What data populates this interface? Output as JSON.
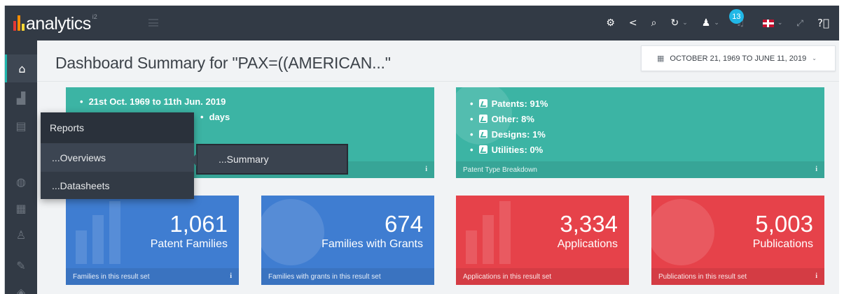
{
  "app": {
    "logo_text": "analytics",
    "logo_sup": "i2",
    "logo_bar_colors": [
      "#e53935",
      "#fb8c00",
      "#fdd835",
      "#43a047"
    ]
  },
  "topbar": {
    "notification_count": "13",
    "icons": [
      "cogs-icon",
      "share-icon",
      "search-icon",
      "refresh-icon",
      "user-icon",
      "bell-icon",
      "flag-icon",
      "fullscreen-icon",
      "help-icon"
    ]
  },
  "sidebar": {
    "icons": [
      "home-icon",
      "chart-icon",
      "document-icon",
      "globe-icon",
      "calendar-icon",
      "person-icon",
      "pen-icon",
      "stack-icon"
    ]
  },
  "header": {
    "title": "Dashboard Summary for \"PAX=((AMERICAN...\"",
    "date_range": "OCTOBER 21, 1969 TO JUNE 11, 2019"
  },
  "cards_top": [
    {
      "lines": [
        "21st Oct. 1969 to 11th Jun. 2019",
        "days"
      ],
      "footer": "",
      "color": "#3cb4a4"
    },
    {
      "lines": [
        "Patents: 91%",
        "Other: 8%",
        "Designs: 1%",
        "Utilities: 0%"
      ],
      "footer": "Patent Type Breakdown",
      "color": "#3cb4a4"
    }
  ],
  "cards_stats": [
    {
      "value": "1,061",
      "label": "Patent Families",
      "footer": "Families in this result set",
      "color": "#3f7dd1"
    },
    {
      "value": "674",
      "label": "Families with Grants",
      "footer": "Families with grants in this result set",
      "color": "#3f7dd1"
    },
    {
      "value": "3,334",
      "label": "Applications",
      "footer": "Applications in this result set",
      "color": "#e6424a"
    },
    {
      "value": "5,003",
      "label": "Publications",
      "footer": "Publications in this result set",
      "color": "#e6424a"
    }
  ],
  "menu": {
    "header": "Reports",
    "items": [
      "...Overviews",
      "...Datasheets"
    ],
    "submenu": "...Summary"
  },
  "info_glyph": "i"
}
